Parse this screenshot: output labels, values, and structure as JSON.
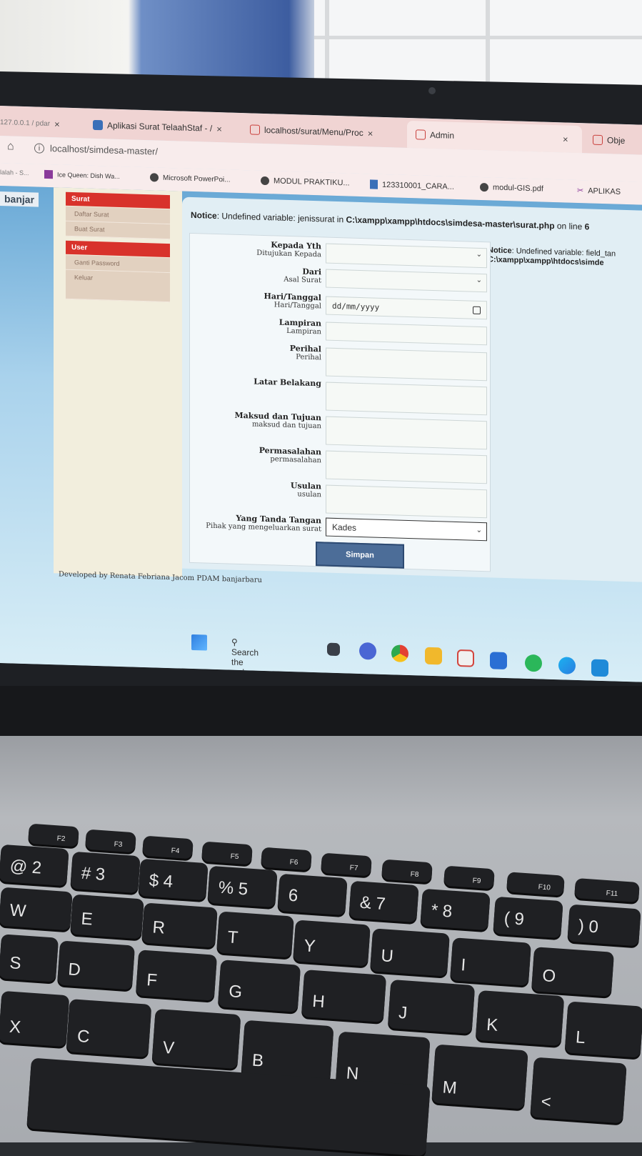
{
  "browser": {
    "tabs": [
      {
        "label": "127.0.0.1 / pdar",
        "close": "×"
      },
      {
        "label": "Aplikasi Surat TelaahStaf - /",
        "close": "×"
      },
      {
        "label": "localhost/surat/Menu/Proc",
        "close": "×"
      },
      {
        "label": "Admin",
        "close": "×"
      },
      {
        "label": "Obje",
        "close": ""
      }
    ],
    "address": "localhost/simdesa-master/",
    "bookmarks": [
      "lalah - S...",
      "Ice Queen: Dish Wa...",
      "Microsoft PowerPoi...",
      "MODUL PRAKTIKU...",
      "123310001_CARA...",
      "modul-GIS.pdf",
      "APLIKAS"
    ]
  },
  "app": {
    "logo": "banjar",
    "menu": {
      "surat_head": "Surat",
      "surat_items": [
        "Daftar Surat",
        "Buat Surat"
      ],
      "user_head": "User",
      "user_items": [
        "Ganti Password",
        "Keluar"
      ]
    },
    "notice_top": {
      "prefix": "Notice",
      "text": ": Undefined variable: jenissurat in ",
      "path": "C:\\xampp\\xampp\\htdocs\\simdesa-master\\surat.php",
      "suffix": " on line ",
      "line": "6"
    },
    "notice_side": {
      "line1_prefix": "Notice",
      "line1": ": Undefined variable: field_tan",
      "line2": "C:\\xampp\\xampp\\htdocs\\simde"
    },
    "form": {
      "fields": [
        {
          "title": "Kepada Yth",
          "sub": "Ditujukan Kepada",
          "value": "",
          "chev": "⌄"
        },
        {
          "title": "Dari",
          "sub": "Asal Surat",
          "value": "",
          "chev": "⌄"
        },
        {
          "title": "Hari/Tanggal",
          "sub": "Hari/Tanggal",
          "value": "dd/mm/yyyy",
          "chev": ""
        },
        {
          "title": "Lampiran",
          "sub": "Lampiran",
          "value": "",
          "chev": ""
        },
        {
          "title": "Perihal",
          "sub": "Perihal",
          "value": "",
          "chev": ""
        },
        {
          "title": "Latar Belakang",
          "sub": "",
          "value": "",
          "chev": ""
        },
        {
          "title": "Maksud dan Tujuan",
          "sub": "maksud dan tujuan",
          "value": "",
          "chev": ""
        },
        {
          "title": "Permasalahan",
          "sub": "permasalahan",
          "value": "",
          "chev": ""
        },
        {
          "title": "Usulan",
          "sub": "usulan",
          "value": "",
          "chev": ""
        },
        {
          "title": "Yang Tanda Tangan",
          "sub": "Pihak yang mengeluarkan surat",
          "value": "Kades",
          "chev": "⌄"
        }
      ],
      "submit": "Simpan"
    },
    "footer": "Developed by Renata Febriana Jacom PDAM banjarbaru"
  },
  "taskbar": {
    "search": "Search the web",
    "icons": [
      "windows-start-icon",
      "file-explorer-icon",
      "chat-icon",
      "chrome-icon",
      "folder-icon",
      "xampp-icon",
      "store-icon",
      "whatsapp-icon",
      "edge-icon",
      "vscode-icon"
    ]
  },
  "keyboard": {
    "fn_row": [
      "F2",
      "F3",
      "F4",
      "F5",
      "F6",
      "F7",
      "F8",
      "F9",
      "F10",
      "F11"
    ],
    "number_row": [
      "@ 2",
      "# 3",
      "$ 4",
      "% 5",
      "6",
      "& 7",
      "* 8",
      "( 9",
      ") 0"
    ],
    "top_row": [
      "W",
      "E",
      "R",
      "T",
      "Y",
      "U",
      "I",
      "O"
    ],
    "home_row": [
      "S",
      "D",
      "F",
      "G",
      "H",
      "J",
      "K",
      "L"
    ],
    "bottom_row": [
      "X",
      "C",
      "V",
      "B",
      "N",
      "M",
      "<"
    ]
  }
}
